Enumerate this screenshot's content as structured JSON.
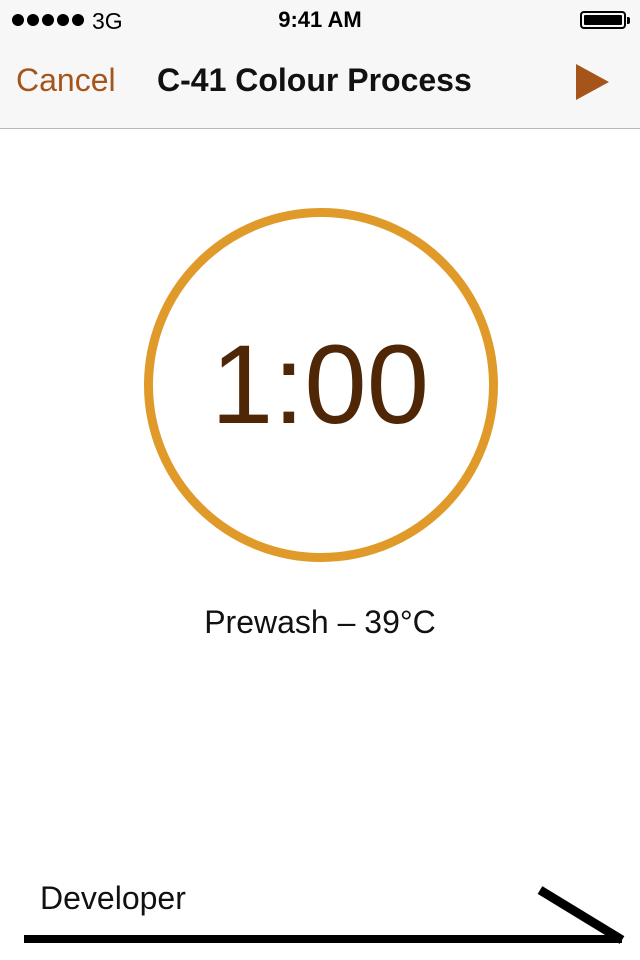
{
  "status_bar": {
    "carrier": "3G",
    "time": "9:41 AM",
    "signal_bars": 5,
    "battery_level": 1.0
  },
  "nav": {
    "cancel_label": "Cancel",
    "title": "C-41 Colour Process",
    "play_icon": "play-icon"
  },
  "timer": {
    "value": "1:00",
    "step_label": "Prewash – 39°C"
  },
  "next_step": {
    "label": "Developer",
    "icon": "next-step-arrow"
  },
  "colors": {
    "accent": "#a6551a",
    "ring": "#e09a2a",
    "timer_text": "#4f2706"
  }
}
